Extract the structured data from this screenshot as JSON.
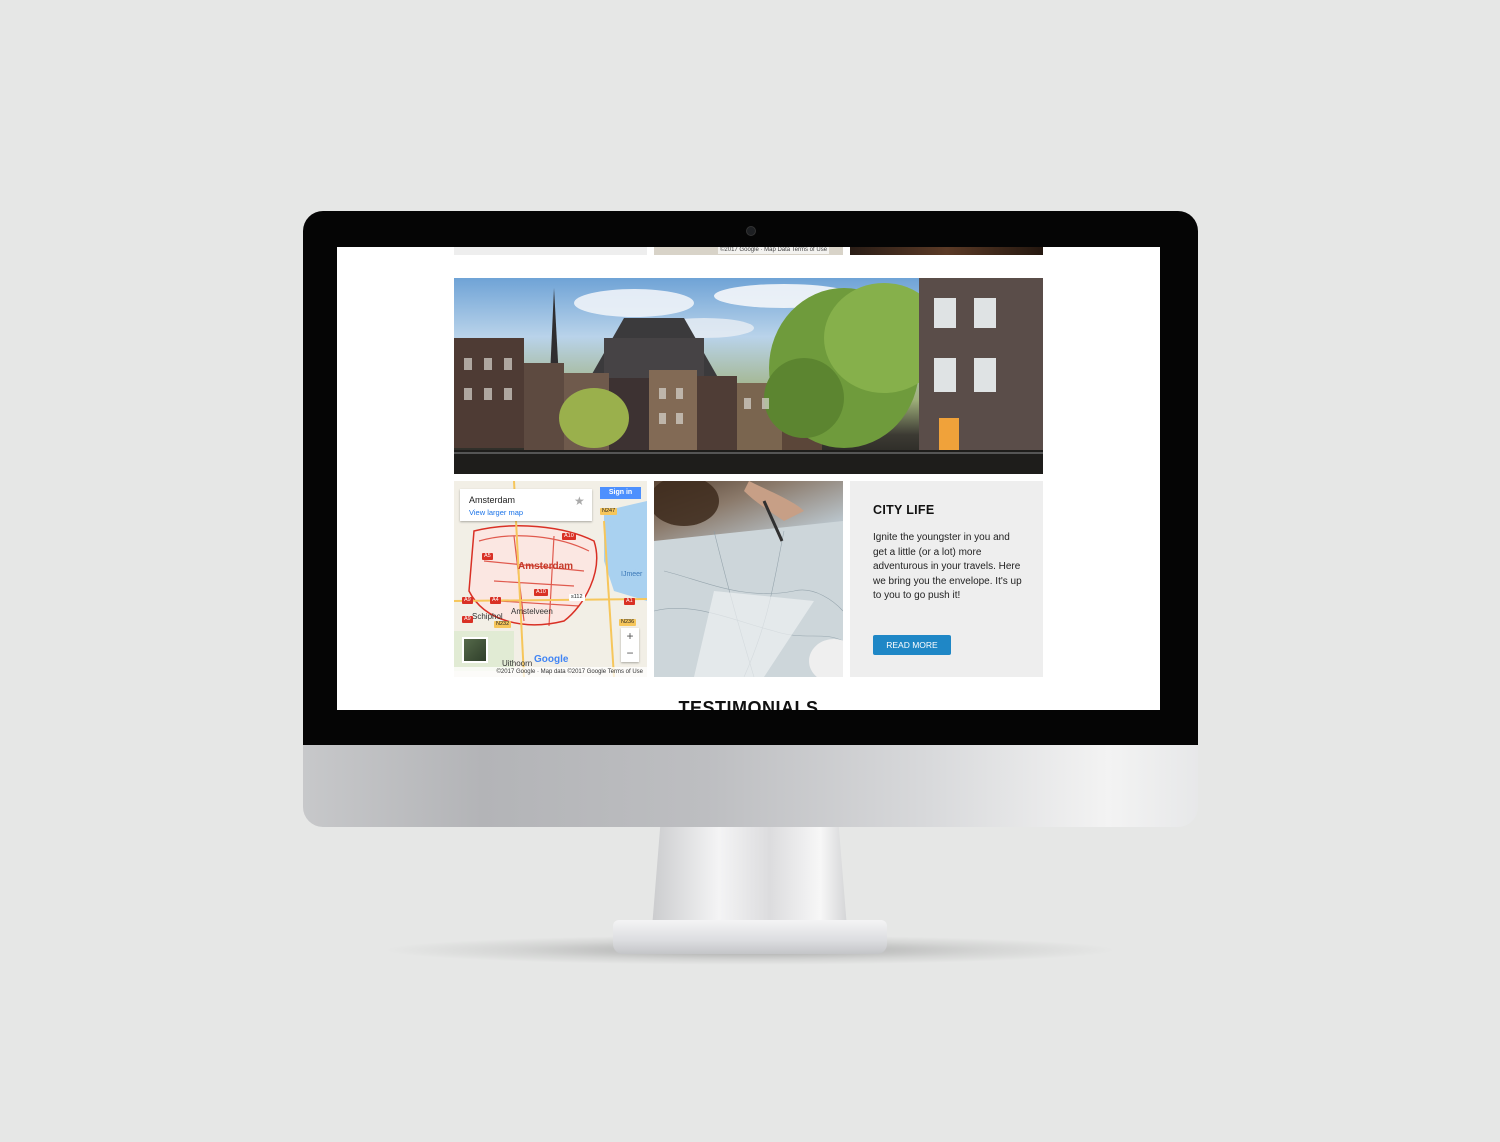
{
  "previous_row": {
    "map_attribution": "©2017 Google · Map Data   Terms of Use"
  },
  "map": {
    "place_name": "Amsterdam",
    "view_larger_link": "View larger map",
    "sign_in_label": "Sign in",
    "zoom_in": "+",
    "zoom_out": "−",
    "star": "★",
    "google_logo": "Google",
    "attribution": "©2017 Google · Map data ©2017 Google    Terms of Use",
    "labels": {
      "amsterdam": "Amsterdam",
      "amstelveen": "Amstelveen",
      "schiphol": "Schiphol",
      "uithoorn": "Uithoorn",
      "ijmeer": "IJmeer",
      "marken": "Marken"
    },
    "road_shields": [
      "N247",
      "A10",
      "A5",
      "A10",
      "A4",
      "A9",
      "s112",
      "A1",
      "N232",
      "N236",
      "A9"
    ]
  },
  "card": {
    "title": "CITY LIFE",
    "body": "Ignite the youngster in you and get a little (or a lot) more adventurous in your travels. Here we bring you the envelope. It's up to you to go push it!",
    "button_label": "READ MORE",
    "button_color": "#1f87c6"
  },
  "section_heading": "TESTIMONIALS"
}
